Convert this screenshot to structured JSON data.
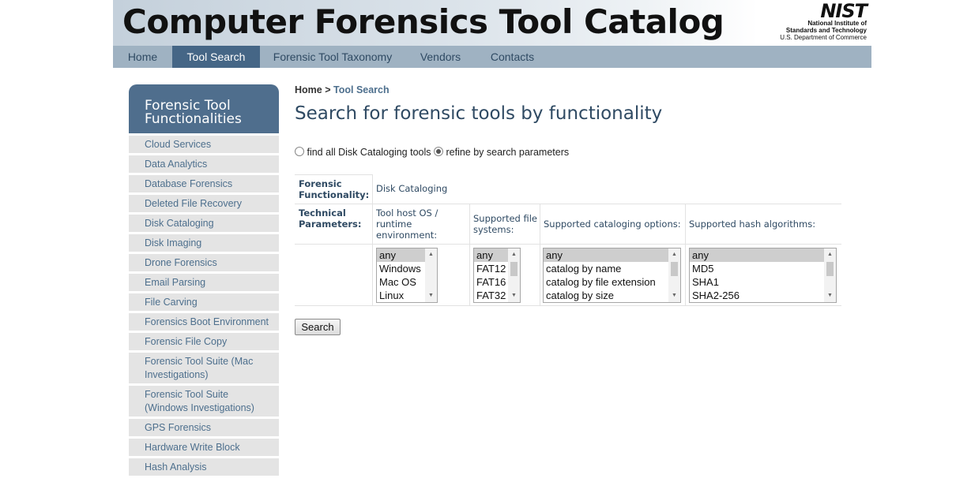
{
  "site": {
    "title": "Computer Forensics Tool Catalog",
    "logo_text": "NIST",
    "logo_line1": "National Institute of",
    "logo_line2": "Standards and Technology",
    "logo_line3": "U.S. Department of Commerce"
  },
  "nav": {
    "items": [
      "Home",
      "Tool Search",
      "Forensic Tool Taxonomy",
      "Vendors",
      "Contacts"
    ],
    "active": "Tool Search"
  },
  "sidebar": {
    "title_line1": "Forensic Tool",
    "title_line2": "Functionalities",
    "items": [
      "Cloud Services",
      "Data Analytics",
      "Database Forensics",
      "Deleted File Recovery",
      "Disk Cataloging",
      "Disk Imaging",
      "Drone Forensics",
      "Email Parsing",
      "File Carving",
      "Forensics Boot Environment",
      "Forensic File Copy",
      "Forensic Tool Suite (Mac Investigations)",
      "Forensic Tool Suite (Windows Investigations)",
      "GPS Forensics",
      "Hardware Write Block",
      "Hash Analysis"
    ]
  },
  "breadcrumb": {
    "home": "Home",
    "separator": ">",
    "current": "Tool Search"
  },
  "heading": "Search for forensic tools by functionality",
  "search_mode": {
    "option1": "find all Disk Cataloging tools",
    "option2": "refine by search parameters",
    "selected": "refine by search parameters"
  },
  "form": {
    "functionality_label": "Forensic Functionality:",
    "functionality_value": "Disk Cataloging",
    "parameters_label": "Technical Parameters:",
    "columns": [
      {
        "header": "Tool host OS / runtime environment:",
        "options": [
          "any",
          "Windows",
          "Mac OS",
          "Linux"
        ],
        "selected": "any"
      },
      {
        "header": "Supported file systems:",
        "options": [
          "any",
          "FAT12",
          "FAT16",
          "FAT32"
        ],
        "selected": "any"
      },
      {
        "header": "Supported cataloging options:",
        "options": [
          "any",
          "catalog by name",
          "catalog by file extension",
          "catalog by size"
        ],
        "selected": "any"
      },
      {
        "header": "Supported hash algorithms:",
        "options": [
          "any",
          "MD5",
          "SHA1",
          "SHA2-256"
        ],
        "selected": "any"
      }
    ],
    "search_button": "Search"
  },
  "colors": {
    "nav_bg": "#9fb2c2",
    "nav_active": "#456686",
    "sidebar_head": "#4f6e8d",
    "link": "#4d6f8d",
    "heading": "#2f4a63"
  }
}
